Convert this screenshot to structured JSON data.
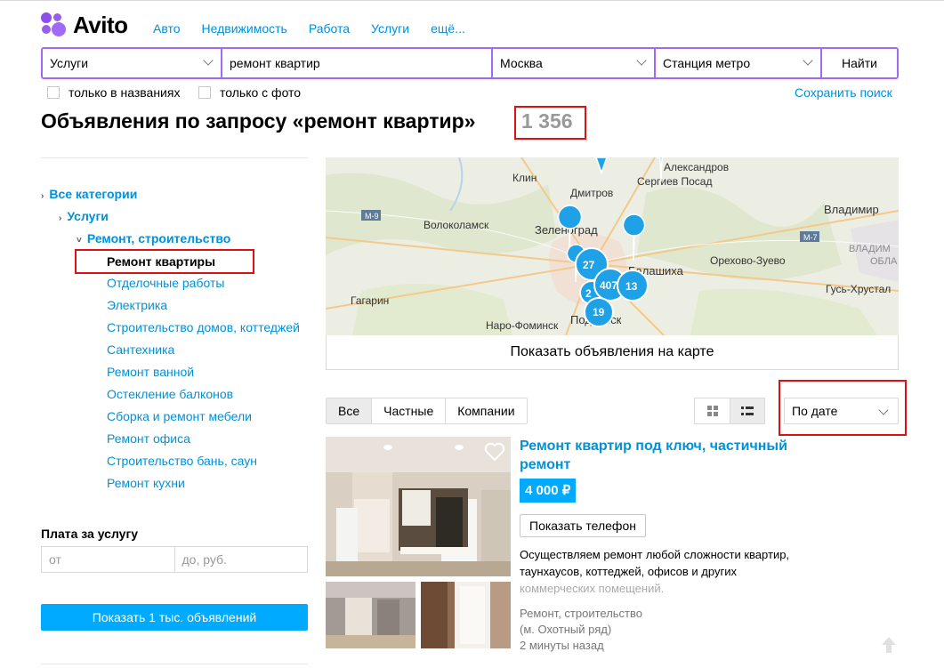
{
  "header": {
    "logo_text": "Avito",
    "nav": [
      "Авто",
      "Недвижимость",
      "Работа",
      "Услуги",
      "ещё..."
    ]
  },
  "search": {
    "category": "Услуги",
    "query": "ремонт квартир",
    "city": "Москва",
    "metro": "Станция метро",
    "submit": "Найти",
    "opt_titles": "только в названиях",
    "opt_photo": "только с фото",
    "save": "Сохранить поиск"
  },
  "page": {
    "title": "Объявления по запросу «ремонт квартир»",
    "count": "1 356"
  },
  "sidebar": {
    "all": "Все категории",
    "services": "Услуги",
    "repair": "Ремонт, строительство",
    "current": "Ремонт квартиры",
    "items": [
      "Отделочные работы",
      "Электрика",
      "Строительство домов, коттеджей",
      "Сантехника",
      "Ремонт ванной",
      "Остекление балконов",
      "Сборка и ремонт мебели",
      "Ремонт офиса",
      "Строительство бань, саун",
      "Ремонт кухни"
    ],
    "price_title": "Плата за услугу",
    "price_from": "от",
    "price_to": "до, руб.",
    "show_button": "Показать 1 тыс. объявлений"
  },
  "map": {
    "labels": {
      "klin": "Клин",
      "dmitrov": "Дмитров",
      "sergiev": "Сергиев Посад",
      "alexandrov": "Александров",
      "vladimir": "Владимир",
      "volokolamsk": "Волоколамск",
      "zelenograd": "Зеленоград",
      "balashikha": "Балашиха",
      "orekhovo": "Орехово-Зуево",
      "vladim_obl1": "ВЛАДИМ",
      "vladim_obl2": "ОБЛА",
      "gus": "Гусь-Хрустал",
      "gagarin": "Гагарин",
      "naro": "Наро-Фоминск",
      "podolsk": "Подольск",
      "m9": "М-9",
      "m7": "М-7"
    },
    "clusters": [
      "27",
      "407",
      "13",
      "2",
      "19"
    ],
    "button": "Показать объявления на карте"
  },
  "filters": {
    "segments": [
      "Все",
      "Частные",
      "Компании"
    ],
    "sort": "По дате"
  },
  "listing": {
    "title": "Ремонт квартир под ключ, частичный ремонт",
    "price": "4 000 ₽",
    "phone_button": "Показать телефон",
    "desc_visible": "Осуществляем ремонт любой сложности квартир, таунхаусов, коттеджей, офисов и других",
    "desc_faded": "коммерческих помещений.",
    "category": "Ремонт, строительство",
    "metro": "(м. Охотный ряд)",
    "time": "2 минуты назад"
  },
  "colors": {
    "link": "#0091d9",
    "accent": "#a169f7",
    "button": "#00aaff",
    "highlight": "#dd1111"
  }
}
